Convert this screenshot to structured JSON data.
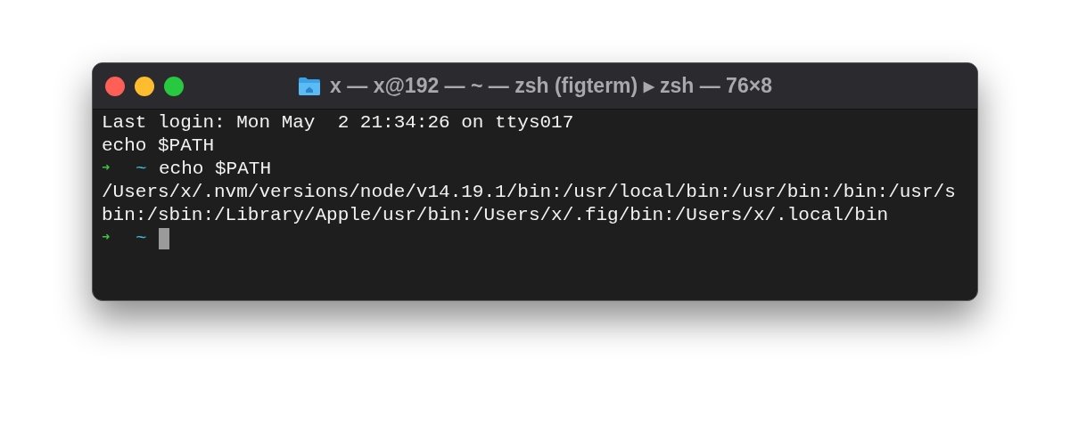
{
  "window": {
    "title": "x — x@192 — ~ — zsh (figterm) ▸ zsh — 76×8"
  },
  "lines": [
    {
      "kind": "output",
      "text": "Last login: Mon May  2 21:34:26 on ttys017"
    },
    {
      "kind": "output",
      "text": "echo $PATH"
    },
    {
      "kind": "prompt",
      "arrow": "➜",
      "dir": "~",
      "command": "echo $PATH"
    },
    {
      "kind": "output",
      "text": "/Users/x/.nvm/versions/node/v14.19.1/bin:/usr/local/bin:/usr/bin:/bin:/usr/s"
    },
    {
      "kind": "output",
      "text": "bin:/sbin:/Library/Apple/usr/bin:/Users/x/.fig/bin:/Users/x/.local/bin"
    },
    {
      "kind": "prompt",
      "arrow": "➜",
      "dir": "~",
      "cursor": true
    }
  ]
}
